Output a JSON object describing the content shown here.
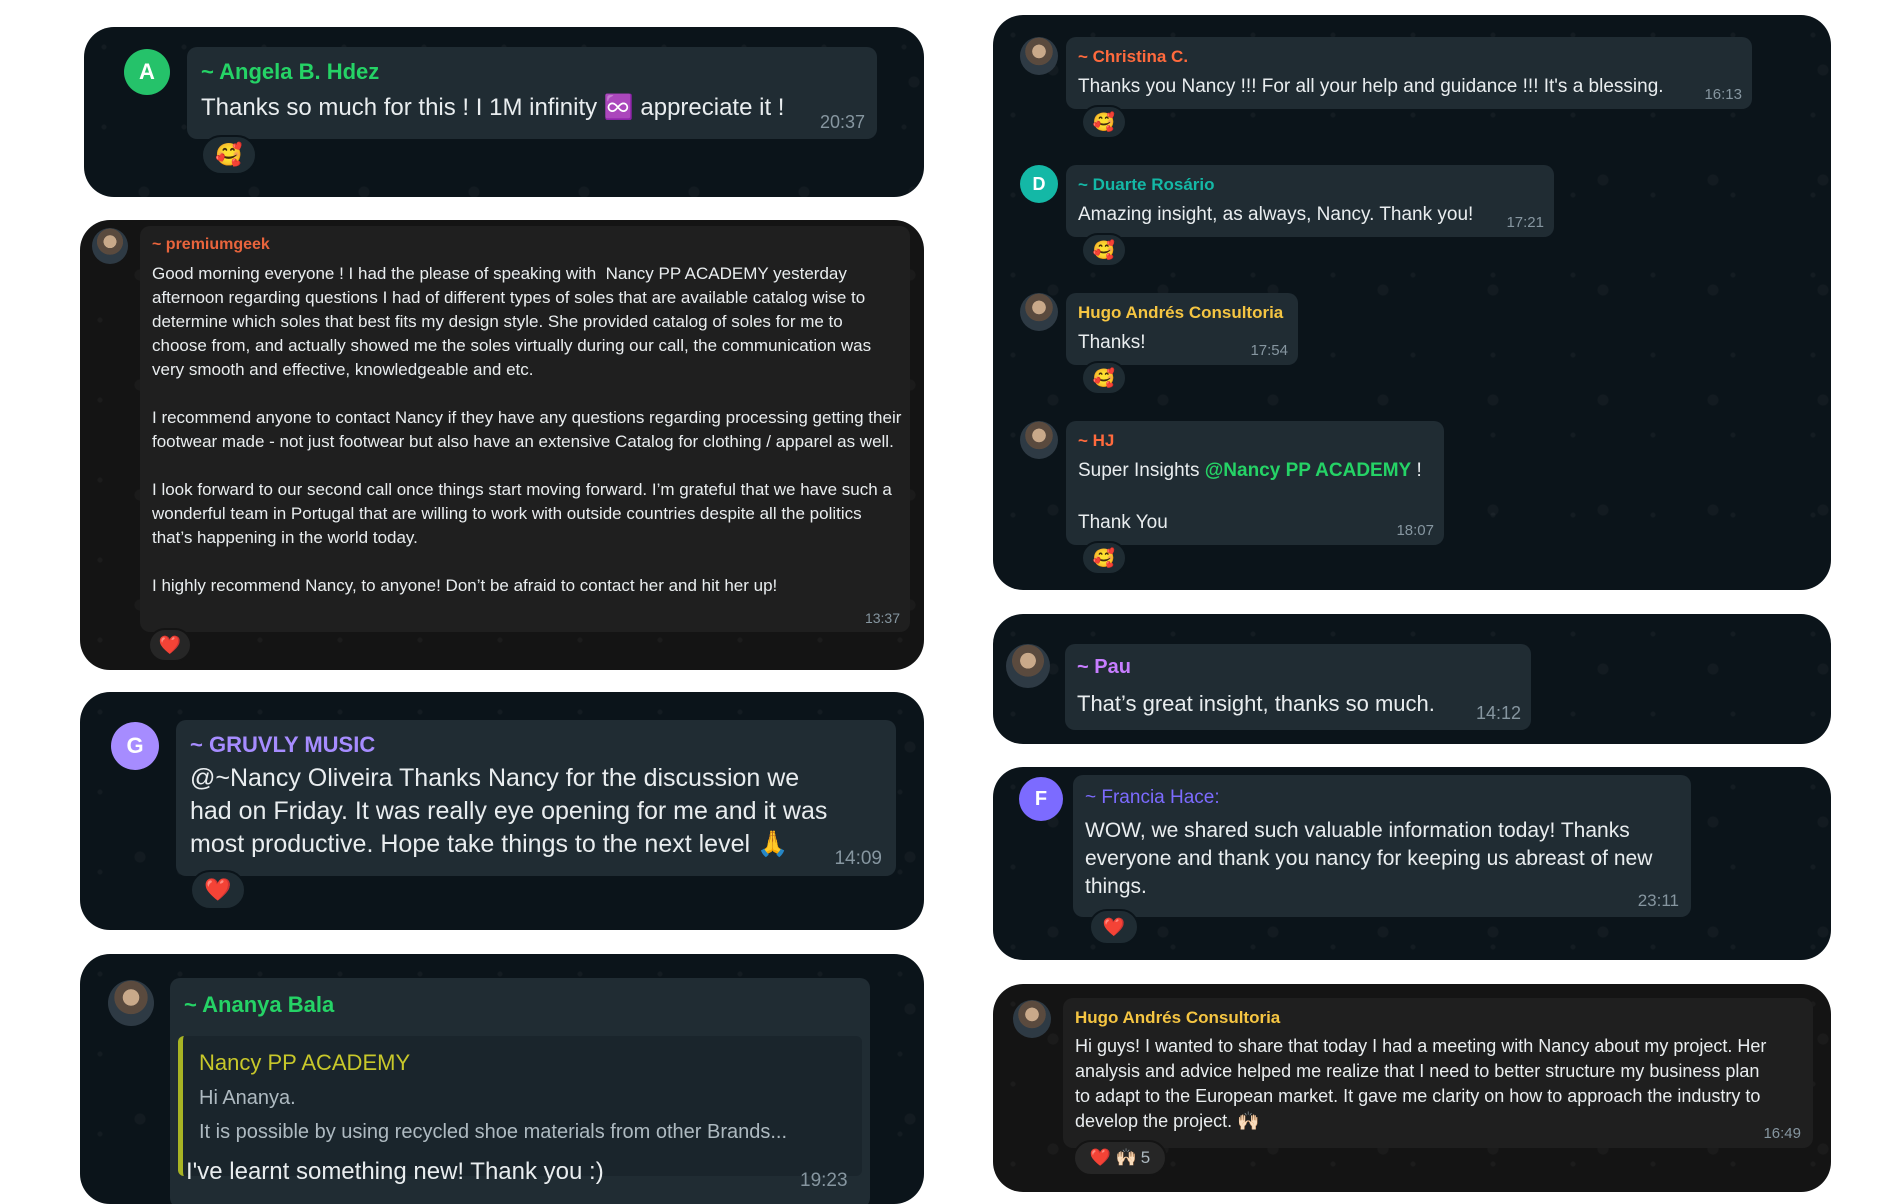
{
  "messages": {
    "angela": {
      "sender": "~ Angela B. Hdez",
      "avatar_letter": "A",
      "text": "Thanks so much for this ! I 1M infinity ",
      "text_after": " appreciate it !",
      "infinity": "♾️",
      "time": "20:37",
      "reaction": "🥰",
      "color": "#25d366"
    },
    "premium": {
      "sender": "~ premiumgeek",
      "text": "Good morning everyone ! I had the please of speaking with  Nancy PP ACADEMY yesterday afternoon regarding questions I had of different types of soles that are available catalog wise to determine which soles that best fits my design style. She provided catalog of soles for me to choose from, and actually showed me the soles virtually during our call, the communication was very smooth and effective, knowledgeable and etc.\n\nI recommend anyone to contact Nancy if they have any questions regarding processing getting their footwear made - not just footwear but also have an extensive Catalog for clothing / apparel as well.\n\nI look forward to our second call once things start moving forward. I’m grateful that we have such a wonderful team in Portugal that are willing to work with outside countries despite all the politics that’s happening in the world today.\n\nI highly recommend Nancy, to anyone! Don’t be afraid to contact her and hit her up!",
      "time": "13:37",
      "reaction": "❤️",
      "color": "#e8643c"
    },
    "gruvly": {
      "sender": "~ GRUVLY MUSIC",
      "avatar_letter": "G",
      "text": "@~Nancy Oliveira Thanks Nancy for the discussion we had on Friday. It was really eye opening for me and it was most productive. Hope take things to the next level 🙏",
      "time": "14:09",
      "reaction": "❤️",
      "color": "#a68cff"
    },
    "ananya": {
      "sender": "~ Ananya Bala",
      "quote_author": "Nancy PP ACADEMY",
      "quote_line1": "Hi Ananya.",
      "quote_line2": "It is possible by using recycled shoe materials from other Brands...",
      "text": "I've learnt something new! Thank you :)",
      "time": "19:23",
      "color": "#25d366",
      "quote_color": "#c8c82a"
    },
    "christina": {
      "sender": "~ Christina C.",
      "text": "Thanks you Nancy !!! For all your help and guidance !!! It's a blessing.",
      "time": "16:13",
      "reaction": "🥰",
      "color": "#ff6a3d"
    },
    "duarte": {
      "sender": "~ Duarte Rosário",
      "avatar_letter": "D",
      "text": "Amazing insight, as always, Nancy. Thank you!",
      "time": "17:21",
      "reaction": "🥰",
      "color": "#14b8a6"
    },
    "hugo1": {
      "sender": "Hugo Andrés Consultoria",
      "text": "Thanks!",
      "time": "17:54",
      "reaction": "🥰",
      "color": "#f5c542"
    },
    "hj": {
      "sender": "~ HJ",
      "text_before": "Super Insights ",
      "mention": "@Nancy PP ACADEMY",
      "text_after": " !",
      "line2": "Thank You",
      "time": "18:07",
      "reaction": "🥰",
      "color": "#ff6a3d"
    },
    "pau": {
      "sender": "~ Pau",
      "text": "That’s great insight, thanks so much.",
      "time": "14:12",
      "color": "#c77dff"
    },
    "francia": {
      "sender": "~ Francia Hace:",
      "avatar_letter": "F",
      "text": "WOW, we shared such valuable information today! Thanks everyone and thank you nancy for keeping us abreast of new things.",
      "time": "23:11",
      "reaction": "❤️",
      "color": "#7c6bff"
    },
    "hugo2": {
      "sender": "Hugo Andrés Consultoria",
      "text": "Hi guys! I wanted to share that today I had a meeting with Nancy about my project. Her analysis and advice helped me realize that I need to better structure my business plan to adapt to the European market. It gave me clarity on how to approach the industry to develop the project. 🙌🏻",
      "time": "16:49",
      "reaction": "❤️ 🙌🏻",
      "reaction_count": "5",
      "color": "#f5c542"
    }
  }
}
